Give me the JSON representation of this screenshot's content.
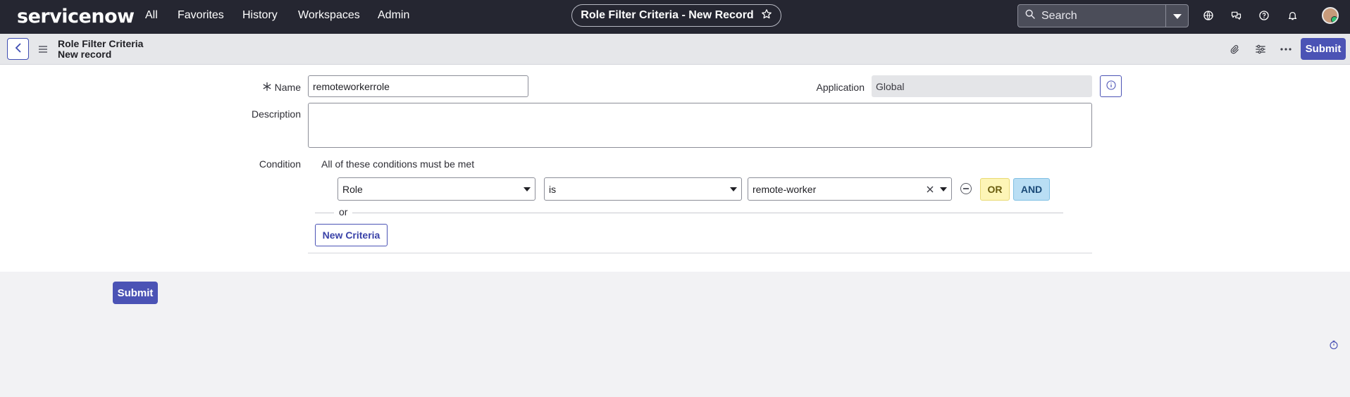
{
  "topnav": {
    "logo": "servicenow",
    "items": [
      "All",
      "Favorites",
      "History",
      "Workspaces",
      "Admin"
    ],
    "record_title": "Role Filter Criteria - New Record",
    "search_placeholder": "Search",
    "icons": [
      "globe-icon",
      "chat-icon",
      "help-icon",
      "bell-icon"
    ]
  },
  "subheader": {
    "title": "Role Filter Criteria",
    "subtitle": "New record",
    "submit_label": "Submit"
  },
  "form": {
    "name_label": "Name",
    "name_value": "remoteworkerrole",
    "application_label": "Application",
    "application_value": "Global",
    "description_label": "Description",
    "description_value": "",
    "condition_label": "Condition",
    "condition_text": "All of these conditions must be met",
    "condition": {
      "field": "Role",
      "operator": "is",
      "value": "remote-worker"
    },
    "or_button": "OR",
    "and_button": "AND",
    "or_separator": "or",
    "new_criteria_label": "New Criteria"
  },
  "footer": {
    "submit_label": "Submit"
  },
  "colors": {
    "topbar": "#252631",
    "accent": "#4b53b5",
    "or_bg": "#fdf5b7",
    "and_bg": "#b9def4"
  }
}
